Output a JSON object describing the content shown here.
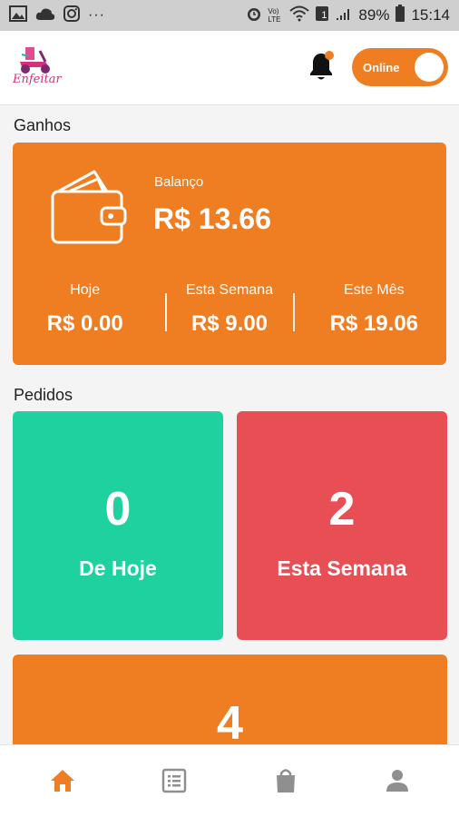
{
  "status_bar": {
    "battery": "89%",
    "time": "15:14",
    "lte": "Vo) LTE",
    "sim": "1",
    "dots": "···"
  },
  "header": {
    "logo_text": "Enfeitar",
    "toggle_label": "Online",
    "notification_dot_color": "#ef7d22"
  },
  "earnings": {
    "section_title": "Ganhos",
    "balance_label": "Balanço",
    "balance_value": "R$ 13.66",
    "stats": [
      {
        "label": "Hoje",
        "value": "R$ 0.00"
      },
      {
        "label": "Esta Semana",
        "value": "R$ 9.00"
      },
      {
        "label": "Este Mês",
        "value": "R$ 19.06"
      }
    ]
  },
  "orders": {
    "section_title": "Pedidos",
    "cards": [
      {
        "count": "0",
        "label": "De Hoje",
        "color": "#1fd19f"
      },
      {
        "count": "2",
        "label": "Esta Semana",
        "color": "#e84f54"
      },
      {
        "count": "4",
        "label": "",
        "color": "#ef7d22"
      }
    ]
  },
  "bottom_nav": {
    "items": [
      {
        "icon": "home-icon",
        "active": true
      },
      {
        "icon": "list-icon",
        "active": false
      },
      {
        "icon": "shopping-bag-icon",
        "active": false
      },
      {
        "icon": "person-icon",
        "active": false
      }
    ],
    "active_color": "#ef7d22",
    "inactive_color": "#8f8f8f"
  }
}
